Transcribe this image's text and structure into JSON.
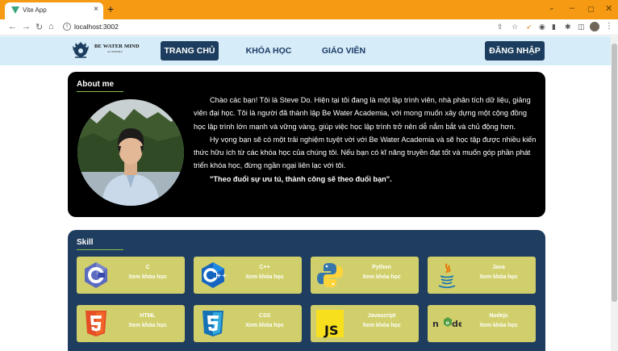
{
  "browser": {
    "tab_title": "Vite App",
    "tab_close": "×",
    "new_tab": "+",
    "url": "localhost:3002"
  },
  "nav": {
    "logo_name": "BE WATER MIND",
    "logo_sub": "ACADEMIA",
    "links": [
      "TRANG CHỦ",
      "KHÓA HỌC",
      "GIÁO VIÊN"
    ],
    "login": "ĐĂNG NHẬP"
  },
  "about": {
    "title": "About me",
    "paragraph1": "Chào các bạn! Tôi là Steve Do. Hiện tại tôi đang là một lập trình viên, nhà phân tích dữ liệu, giảng viên đại học. Tôi là người đã thành lập Be Water Academia, với mong muốn xây dựng một cộng đồng học lập trình lớn mạnh và vững vàng, giúp việc học lập trình trở nên dễ nắm bắt và chủ động hơn.",
    "paragraph2": "Hy vọng bạn sẽ có một trải nghiệm tuyệt vời với Be Water Academia và sẽ học tập được nhiều kiến thức hữu ích từ các khóa học của chúng tôi. Nếu bạn có kĩ năng truyền đạt tốt và muốn góp phần phát triển khóa học, đừng ngần ngại liên lạc với tôi.",
    "quote": "\"Theo đuổi sự ưu tú, thành công sẽ theo đuổi bạn\"."
  },
  "skill": {
    "title": "Skill",
    "link_label": "Xem khóa học",
    "items": [
      {
        "name": "C",
        "icon": "c-logo-icon"
      },
      {
        "name": "C++",
        "icon": "cpp-logo-icon"
      },
      {
        "name": "Python",
        "icon": "python-logo-icon"
      },
      {
        "name": "Java",
        "icon": "java-logo-icon"
      },
      {
        "name": "HTML",
        "icon": "html5-logo-icon"
      },
      {
        "name": "CSS",
        "icon": "css3-logo-icon"
      },
      {
        "name": "Javascript",
        "icon": "javascript-logo-icon"
      },
      {
        "name": "Nodejs",
        "icon": "nodejs-logo-icon"
      }
    ]
  },
  "colors": {
    "browser_titlebar": "#f59a12",
    "nav_background": "#d6ecf8",
    "nav_button": "#1c3d5e",
    "skill_background": "#1f3d5f",
    "skill_card": "#d1cf6b",
    "about_background": "#000000"
  }
}
